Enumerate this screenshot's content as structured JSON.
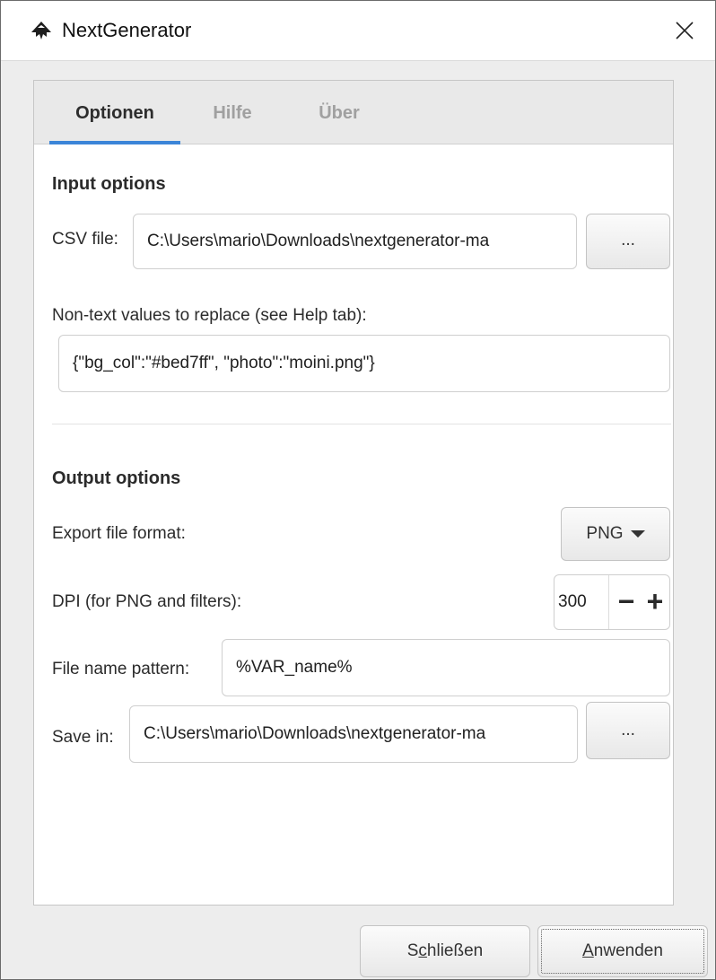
{
  "window": {
    "title": "NextGenerator",
    "app_icon": "inkscape-logo-icon",
    "close_icon": "close-icon"
  },
  "tabs": [
    {
      "label": "Optionen",
      "active": true
    },
    {
      "label": "Hilfe",
      "active": false
    },
    {
      "label": "Über",
      "active": false
    }
  ],
  "input_options": {
    "heading": "Input options",
    "csv_label": "CSV file:",
    "csv_value": "C:\\Users\\mario\\Downloads\\nextgenerator-ma",
    "browse_label": "...",
    "replace_label": "Non-text values to replace (see Help tab):",
    "replace_value": "{\"bg_col\":\"#bed7ff\", \"photo\":\"moini.png\"}"
  },
  "output_options": {
    "heading": "Output options",
    "format_label": "Export file format:",
    "format_value": "PNG",
    "dpi_label": "DPI (for PNG and filters):",
    "dpi_value": "300",
    "dpi_minus": "−",
    "dpi_plus": "+",
    "pattern_label": "File name pattern:",
    "pattern_value": "%VAR_name%",
    "save_label": "Save in:",
    "save_value": "C:\\Users\\mario\\Downloads\\nextgenerator-ma",
    "browse_label": "..."
  },
  "footer": {
    "close_pre": "S",
    "close_mnemonic": "c",
    "close_post": "hließen",
    "apply_mnemonic": "A",
    "apply_post": "nwenden"
  },
  "colors": {
    "accent": "#3b85d8",
    "background": "#ededed"
  }
}
